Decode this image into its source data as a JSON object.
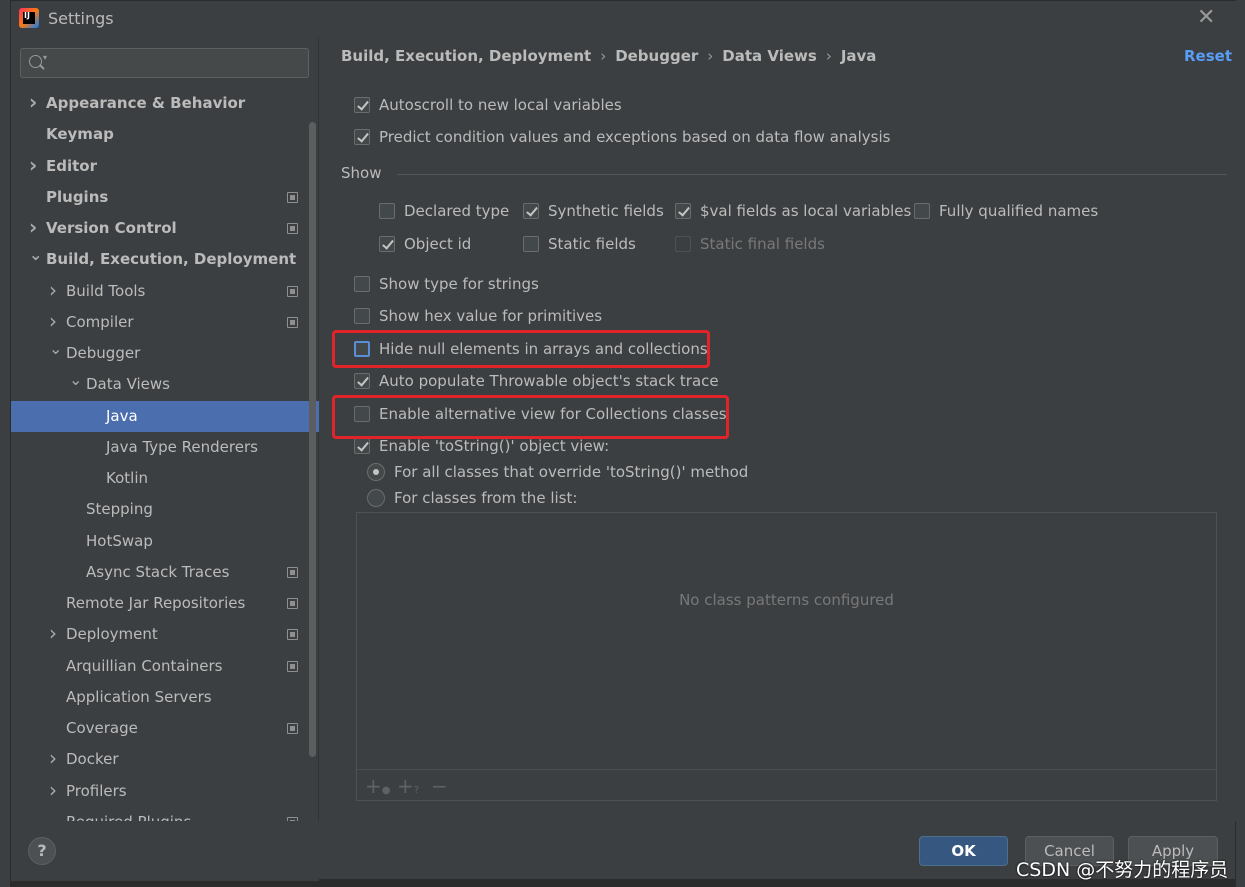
{
  "window": {
    "title": "Settings",
    "close_glyph": "✕"
  },
  "search": {
    "placeholder": ""
  },
  "tree": [
    {
      "label": "Appearance & Behavior",
      "expandable": true,
      "expanded": false
    },
    {
      "label": "Keymap",
      "expandable": false
    },
    {
      "label": "Editor",
      "expandable": true,
      "expanded": false
    },
    {
      "label": "Plugins",
      "expandable": false,
      "project_icon": true
    },
    {
      "label": "Version Control",
      "expandable": true,
      "expanded": false,
      "project_icon": true
    },
    {
      "label": "Build, Execution, Deployment",
      "expandable": true,
      "expanded": true
    },
    {
      "label": "Build Tools",
      "expandable": true,
      "project_icon": true
    },
    {
      "label": "Compiler",
      "expandable": true,
      "project_icon": true
    },
    {
      "label": "Debugger",
      "expandable": true,
      "expanded": true
    },
    {
      "label": "Data Views",
      "expandable": true,
      "expanded": true
    },
    {
      "label": "Java",
      "selected": true
    },
    {
      "label": "Java Type Renderers"
    },
    {
      "label": "Kotlin"
    },
    {
      "label": "Stepping"
    },
    {
      "label": "HotSwap"
    },
    {
      "label": "Async Stack Traces",
      "project_icon": true
    },
    {
      "label": "Remote Jar Repositories",
      "project_icon": true
    },
    {
      "label": "Deployment",
      "expandable": true,
      "project_icon": true
    },
    {
      "label": "Arquillian Containers",
      "project_icon": true
    },
    {
      "label": "Application Servers"
    },
    {
      "label": "Coverage",
      "project_icon": true
    },
    {
      "label": "Docker",
      "expandable": true
    },
    {
      "label": "Profilers",
      "expandable": true
    },
    {
      "label": "Required Plugins",
      "project_icon": true
    }
  ],
  "breadcrumb": [
    "Build, Execution, Deployment",
    "Debugger",
    "Data Views",
    "Java"
  ],
  "breadcrumb_sep": "›",
  "reset_label": "Reset",
  "options": {
    "autoscroll": {
      "label": "Autoscroll to new local variables",
      "checked": true
    },
    "predict": {
      "label": "Predict condition values and exceptions based on data flow analysis",
      "checked": true
    },
    "show_label": "Show",
    "declared_type": {
      "label": "Declared type",
      "checked": false
    },
    "synthetic_fields": {
      "label": "Synthetic fields",
      "checked": true
    },
    "val_fields": {
      "label": "$val fields as local variables",
      "checked": true
    },
    "fully_qualified": {
      "label": "Fully qualified names",
      "checked": false
    },
    "object_id": {
      "label": "Object id",
      "checked": true
    },
    "static_fields": {
      "label": "Static fields",
      "checked": false
    },
    "static_final_fields": {
      "label": "Static final fields",
      "checked": false,
      "disabled": true
    },
    "type_for_strings": {
      "label": "Show type for strings",
      "checked": false
    },
    "hex_value": {
      "label": "Show hex value for primitives",
      "checked": false
    },
    "hide_null": {
      "label": "Hide null elements in arrays and collections",
      "checked": false
    },
    "auto_populate": {
      "label": "Auto populate Throwable object's stack trace",
      "checked": true
    },
    "alt_view": {
      "label": "Enable alternative view for Collections classes",
      "checked": false
    },
    "tostring_view": {
      "label": "Enable 'toString()' object view:",
      "checked": true
    },
    "radio_all": {
      "label": "For all classes that override 'toString()' method",
      "selected": true
    },
    "radio_list": {
      "label": "For classes from the list:",
      "selected": false
    }
  },
  "class_list": {
    "empty_text": "No class patterns configured"
  },
  "buttons": {
    "help": "?",
    "ok": "OK",
    "cancel": "Cancel",
    "apply": "Apply"
  },
  "watermark": "CSDN @不努力的程序员",
  "colors": {
    "selection": "#4b6eaf",
    "link": "#589df6",
    "highlight": "#e0242a",
    "ok_button": "#365880"
  }
}
